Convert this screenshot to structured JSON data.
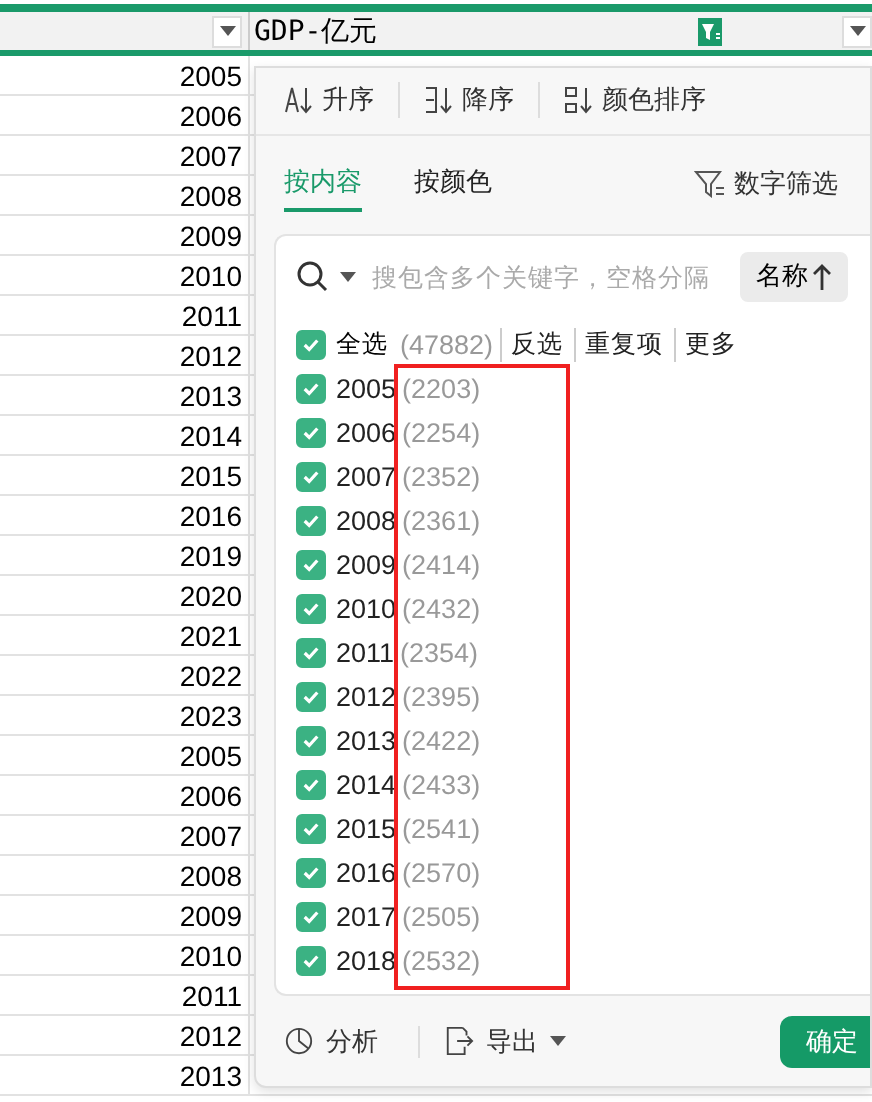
{
  "sheet": {
    "column_b_title": "GDP-亿元",
    "column_b_filtered": true,
    "rows": [
      "2005",
      "2006",
      "2007",
      "2008",
      "2009",
      "2010",
      "2011",
      "2012",
      "2013",
      "2014",
      "2015",
      "2016",
      "2019",
      "2020",
      "2021",
      "2022",
      "2023",
      "2005",
      "2006",
      "2007",
      "2008",
      "2009",
      "2010",
      "2011",
      "2012",
      "2013"
    ]
  },
  "filter_popup": {
    "sort_buttons": [
      {
        "kind": "asc",
        "label": "升序"
      },
      {
        "kind": "desc",
        "label": "降序"
      },
      {
        "kind": "color",
        "label": "颜色排序"
      }
    ],
    "tabs": [
      {
        "label": "按内容",
        "selected": true
      },
      {
        "label": "按颜色",
        "selected": false
      }
    ],
    "number_filter": "数字筛选",
    "search": {
      "placeholder": "搜包含多个关键字，空格分隔"
    },
    "sort_by": "名称",
    "select_all": {
      "label": "全选",
      "count": "(47882)",
      "checked": true
    },
    "actions": [
      "反选",
      "重复项",
      "更多"
    ],
    "items": [
      {
        "label": "2005",
        "count": "(2203)",
        "checked": true
      },
      {
        "label": "2006",
        "count": "(2254)",
        "checked": true
      },
      {
        "label": "2007",
        "count": "(2352)",
        "checked": true
      },
      {
        "label": "2008",
        "count": "(2361)",
        "checked": true
      },
      {
        "label": "2009",
        "count": "(2414)",
        "checked": true
      },
      {
        "label": "2010",
        "count": "(2432)",
        "checked": true
      },
      {
        "label": "2011",
        "count": "(2354)",
        "checked": true
      },
      {
        "label": "2012",
        "count": "(2395)",
        "checked": true
      },
      {
        "label": "2013",
        "count": "(2422)",
        "checked": true
      },
      {
        "label": "2014",
        "count": "(2433)",
        "checked": true
      },
      {
        "label": "2015",
        "count": "(2541)",
        "checked": true
      },
      {
        "label": "2016",
        "count": "(2570)",
        "checked": true
      },
      {
        "label": "2017",
        "count": "(2505)",
        "checked": true
      },
      {
        "label": "2018",
        "count": "(2532)",
        "checked": true
      }
    ],
    "counts_highlighted": true,
    "footer": {
      "analyze": "分析",
      "export": "导出",
      "confirm": "确定"
    }
  }
}
